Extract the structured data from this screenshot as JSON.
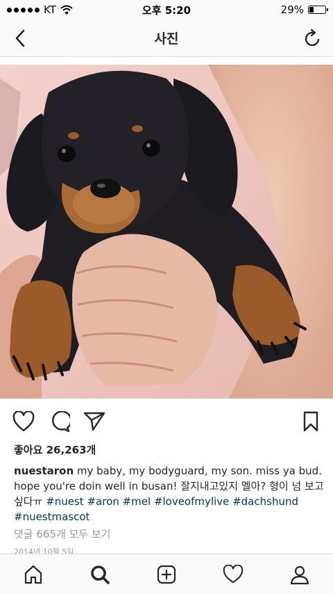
{
  "status_bar": {
    "carrier": "KT",
    "time": "오후 5:20",
    "battery": "29%",
    "battery_level": 0.29
  },
  "nav": {
    "title": "사진",
    "back_icon": "chevron-left-icon",
    "refresh_icon": "refresh-icon"
  },
  "post": {
    "photo_subject": "dachshund-puppy-photo",
    "actions": {
      "like_icon": "heart-outline-icon",
      "comment_icon": "comment-icon",
      "share_icon": "paper-plane-icon",
      "save_icon": "bookmark-icon"
    },
    "likes_text": "좋아요 26,263개",
    "caption": {
      "username": "nuestaron",
      "text": " my baby, my bodyguard, my son. miss ya bud. hope you're doin well in busan! 잘지내고있지 멜아? 형이 넘 보고싶다ㅠ ",
      "hashtags": [
        "#nuest",
        "#aron",
        "#mel",
        "#loveofmylive",
        "#dachshund",
        "#nuestmascot"
      ]
    },
    "view_comments": "댓글 665개 모두 보기",
    "date": "2014년 10월 5일"
  },
  "tab_bar": {
    "items": [
      {
        "name": "home",
        "icon": "home-icon"
      },
      {
        "name": "search",
        "icon": "search-icon"
      },
      {
        "name": "add",
        "icon": "add-post-icon"
      },
      {
        "name": "activity",
        "icon": "heart-icon"
      },
      {
        "name": "profile",
        "icon": "profile-icon"
      }
    ]
  },
  "colors": {
    "text": "#262626",
    "hashtag": "#003569",
    "muted": "#999999",
    "bar_bg": "#fafafa",
    "divider": "#dbdbdb"
  }
}
